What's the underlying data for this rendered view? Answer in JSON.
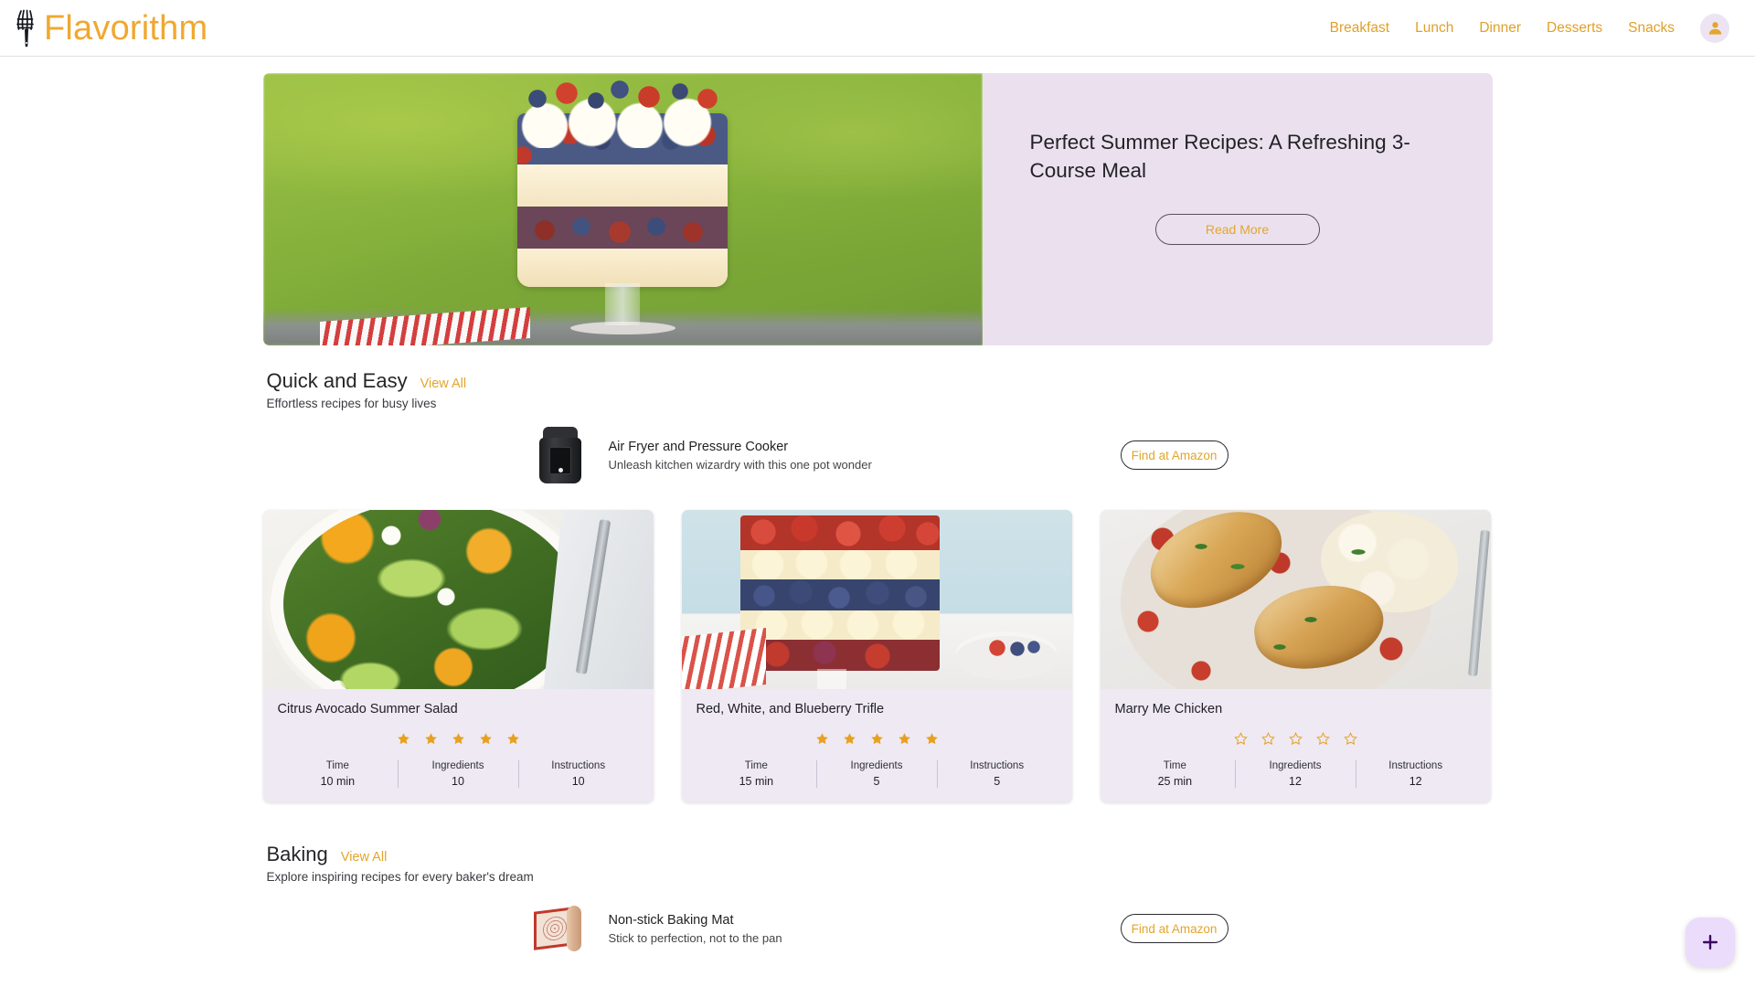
{
  "header": {
    "brand": "Flavorithm",
    "logo_icon": "whisk-icon",
    "nav": [
      {
        "label": "Breakfast"
      },
      {
        "label": "Lunch"
      },
      {
        "label": "Dinner"
      },
      {
        "label": "Desserts"
      },
      {
        "label": "Snacks"
      }
    ],
    "avatar_icon": "user-avatar-icon"
  },
  "hero": {
    "title": "Perfect Summer Recipes: A Refreshing 3-Course Meal",
    "button": "Read More",
    "image_alt": "berry trifle dessert in glass bowl on grass"
  },
  "sections": [
    {
      "title": "Quick and Easy",
      "view_all": "View All",
      "subtitle": "Effortless recipes for busy lives",
      "promo": {
        "name": "Air Fryer and Pressure Cooker",
        "tagline": "Unleash kitchen wizardry with this one pot wonder",
        "button": "Find at Amazon",
        "icon": "pressure-cooker-icon"
      },
      "cards": [
        {
          "title": "Citrus Avocado Summer Salad",
          "rating": 5,
          "rating_filled": true,
          "stats": [
            {
              "label": "Time",
              "value": "10 min"
            },
            {
              "label": "Ingredients",
              "value": "10"
            },
            {
              "label": "Instructions",
              "value": "10"
            }
          ]
        },
        {
          "title": "Red, White, and Blueberry Trifle",
          "rating": 5,
          "rating_filled": true,
          "stats": [
            {
              "label": "Time",
              "value": "15 min"
            },
            {
              "label": "Ingredients",
              "value": "5"
            },
            {
              "label": "Instructions",
              "value": "5"
            }
          ]
        },
        {
          "title": "Marry Me Chicken",
          "rating": 0,
          "rating_filled": false,
          "stats": [
            {
              "label": "Time",
              "value": "25 min"
            },
            {
              "label": "Ingredients",
              "value": "12"
            },
            {
              "label": "Instructions",
              "value": "12"
            }
          ]
        }
      ]
    },
    {
      "title": "Baking",
      "view_all": "View All",
      "subtitle": "Explore inspiring recipes for every baker's dream",
      "promo": {
        "name": "Non-stick Baking Mat",
        "tagline": "Stick to perfection, not to the pan",
        "button": "Find at Amazon",
        "icon": "baking-mat-icon"
      }
    }
  ],
  "fab": {
    "icon": "plus-icon"
  },
  "colors": {
    "brand_orange": "#F0A830",
    "accent_orange": "#E3A52C",
    "panel_lavender": "#EBE1EE",
    "card_lavender": "#EEE9F3",
    "fab_lavender": "#EADCFA",
    "fab_plus": "#3B0A63",
    "text_dark": "#222226"
  }
}
